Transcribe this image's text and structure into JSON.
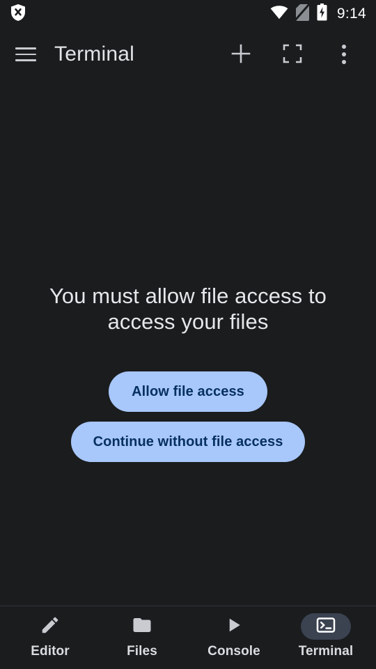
{
  "status_bar": {
    "left_icons": [
      {
        "name": "shield-x-icon",
        "label": "VPN disabled"
      }
    ],
    "right_icons": [
      {
        "name": "wifi-icon",
        "label": "Wi-Fi connected"
      },
      {
        "name": "no-sim-icon",
        "label": "No SIM"
      },
      {
        "name": "battery-charging-icon",
        "label": "Battery charging"
      }
    ],
    "time": "9:14"
  },
  "app_bar": {
    "menu_label": "Open navigation menu",
    "title": "Terminal",
    "actions": [
      {
        "name": "add-session-button",
        "label": "New session"
      },
      {
        "name": "fullscreen-button",
        "label": "Fullscreen"
      },
      {
        "name": "overflow-menu-button",
        "label": "More options"
      }
    ]
  },
  "main": {
    "message": "You must allow file access to access your files",
    "primary_button": "Allow file access",
    "secondary_button": "Continue without file access"
  },
  "bottom_nav": {
    "items": [
      {
        "label": "Editor",
        "icon": "pencil-icon",
        "selected": false
      },
      {
        "label": "Files",
        "icon": "folder-icon",
        "selected": false
      },
      {
        "label": "Console",
        "icon": "play-icon",
        "selected": false
      },
      {
        "label": "Terminal",
        "icon": "terminal-icon",
        "selected": true
      }
    ]
  },
  "colors": {
    "background": "#1a1c1e",
    "button_fill": "#a8c7fa",
    "button_text": "#05305f",
    "nav_selected_pill": "#3b4250",
    "icon": "#c9cbd1",
    "text": "#e6e7ea"
  }
}
